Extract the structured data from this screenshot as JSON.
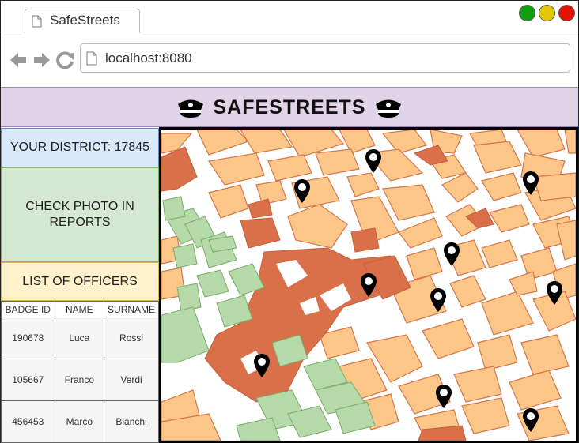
{
  "browser": {
    "tab_title": "SafeStreets",
    "address": "localhost:8080",
    "window_buttons": [
      {
        "name": "minimize-button",
        "color": "#12a012"
      },
      {
        "name": "maximize-button",
        "color": "#e3c800"
      },
      {
        "name": "close-button",
        "color": "#e51400"
      }
    ],
    "icons": {
      "back": "arrow-left-icon",
      "forward": "arrow-right-icon",
      "reload": "reload-icon",
      "page": "page-icon"
    }
  },
  "header": {
    "title": "SAFESTREETS",
    "icon": "police-cap-icon",
    "background": "#e1d4e8"
  },
  "sidebar": {
    "district_label": "YOUR DISTRICT: 17845",
    "check_photo_label": "CHECK PHOTO IN REPORTS",
    "officers_label": "LIST OF OFFICERS"
  },
  "officers_table": {
    "columns": [
      "BADGE ID",
      "NAME",
      "SURNAME"
    ],
    "rows": [
      [
        "190678",
        "Luca",
        "Rossi"
      ],
      [
        "105667",
        "Franco",
        "Verdi"
      ],
      [
        "456453",
        "Marco",
        "Bianchi"
      ]
    ]
  },
  "map": {
    "pin_count": 10,
    "pin_icon": "map-pin-icon",
    "colors": {
      "block": "#fdc689",
      "block_stroke": "#d4774a",
      "plaza": "#d9704a",
      "park": "#b5d9a8"
    }
  }
}
